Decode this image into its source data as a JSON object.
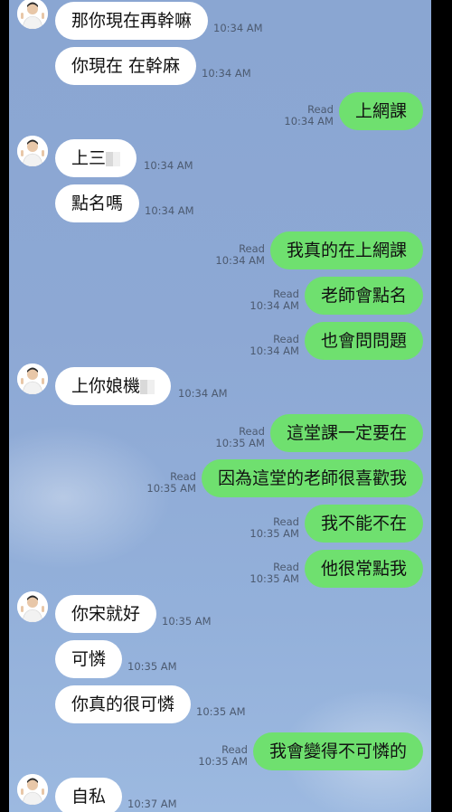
{
  "chat": {
    "messages": [
      {
        "side": "in",
        "text": "那你現在再幹嘛",
        "time": "10:34 AM",
        "avatar": true
      },
      {
        "side": "in",
        "text": "你現在 在幹麻",
        "time": "10:34 AM"
      },
      {
        "side": "out",
        "text": "上網課",
        "time": "10:34 AM",
        "read": "Read"
      },
      {
        "side": "in",
        "text": "上三",
        "time": "10:34 AM",
        "avatar": true,
        "redacted": true
      },
      {
        "side": "in",
        "text": "點名嗎",
        "time": "10:34 AM"
      },
      {
        "side": "out",
        "text": "我真的在上網課",
        "time": "10:34 AM",
        "read": "Read"
      },
      {
        "side": "out",
        "text": "老師會點名",
        "time": "10:34 AM",
        "read": "Read"
      },
      {
        "side": "out",
        "text": "也會問問題",
        "time": "10:34 AM",
        "read": "Read"
      },
      {
        "side": "in",
        "text": "上你娘機",
        "time": "10:34 AM",
        "avatar": true,
        "redacted": true
      },
      {
        "side": "out",
        "text": "這堂課一定要在",
        "time": "10:35 AM",
        "read": "Read"
      },
      {
        "side": "out",
        "text": "因為這堂的老師很喜歡我",
        "time": "10:35 AM",
        "read": "Read"
      },
      {
        "side": "out",
        "text": "我不能不在",
        "time": "10:35 AM",
        "read": "Read"
      },
      {
        "side": "out",
        "text": "他很常點我",
        "time": "10:35 AM",
        "read": "Read"
      },
      {
        "side": "in",
        "text": "你宋就好",
        "time": "10:35 AM",
        "avatar": true
      },
      {
        "side": "in",
        "text": "可憐",
        "time": "10:35 AM"
      },
      {
        "side": "in",
        "text": "你真的很可憐",
        "time": "10:35 AM"
      },
      {
        "side": "out",
        "text": "我會變得不可憐的",
        "time": "10:35 AM",
        "read": "Read"
      },
      {
        "side": "in",
        "text": "自私",
        "time": "10:37 AM",
        "avatar": true
      }
    ]
  },
  "colors": {
    "outgoing_bubble": "#6fe06f",
    "incoming_bubble": "#ffffff",
    "background": "#8da8d4"
  }
}
